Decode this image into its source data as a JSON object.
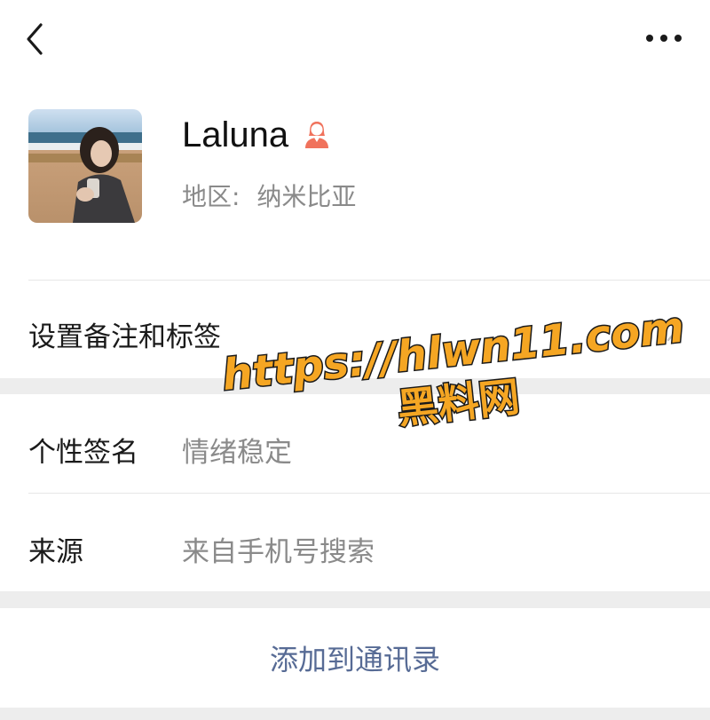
{
  "header": {
    "back_icon": "chevron-left-icon",
    "more_icon": "more-dots-icon"
  },
  "profile": {
    "nickname": "Laluna",
    "gender_icon": "female-icon",
    "gender_color": "#f0725c",
    "region_label": "地区:",
    "region_value": "纳米比亚"
  },
  "rows": {
    "remark_label": "设置备注和标签",
    "signature_label": "个性签名",
    "signature_value": "情绪稳定",
    "source_label": "来源",
    "source_value": "来自手机号搜索"
  },
  "actions": {
    "add_contact_label": "添加到通讯录",
    "link_color": "#576b95"
  },
  "watermark": {
    "line1": "https://hlwn11.com",
    "line2": "黑料网",
    "fill_color": "#f5a623"
  }
}
